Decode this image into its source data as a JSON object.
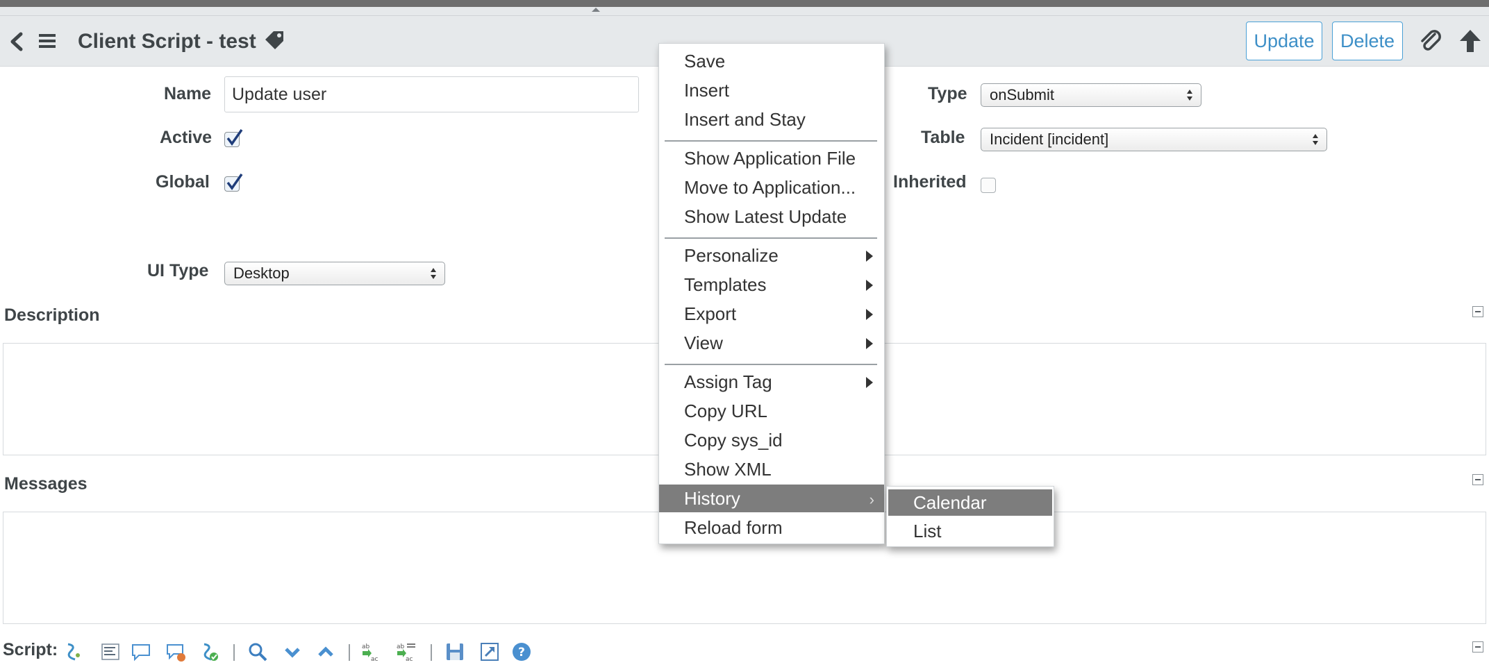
{
  "header": {
    "title": "Client Script - test",
    "update_label": "Update",
    "delete_label": "Delete"
  },
  "form": {
    "name_label": "Name",
    "name_value": "Update user",
    "active_label": "Active",
    "active_checked": true,
    "global_label": "Global",
    "global_checked": true,
    "ui_type_label": "UI Type",
    "ui_type_value": "Desktop",
    "type_label": "Type",
    "type_value": "onSubmit",
    "table_label": "Table",
    "table_value": "Incident [incident]",
    "inherited_label": "Inherited",
    "inherited_checked": false
  },
  "sections": {
    "description_label": "Description",
    "messages_label": "Messages",
    "script_label": "Script:"
  },
  "context_menu": {
    "items": [
      {
        "label": "Save"
      },
      {
        "label": "Insert"
      },
      {
        "label": "Insert and Stay"
      },
      {
        "label": "Show Application File"
      },
      {
        "label": "Move to Application..."
      },
      {
        "label": "Show Latest Update"
      },
      {
        "label": "Personalize",
        "submenu": true
      },
      {
        "label": "Templates",
        "submenu": true
      },
      {
        "label": "Export",
        "submenu": true
      },
      {
        "label": "View",
        "submenu": true
      },
      {
        "label": "Assign Tag",
        "submenu": true
      },
      {
        "label": "Copy URL"
      },
      {
        "label": "Copy sys_id"
      },
      {
        "label": "Show XML"
      },
      {
        "label": "History",
        "submenu": true,
        "active": true
      },
      {
        "label": "Reload form"
      }
    ]
  },
  "history_submenu": {
    "items": [
      {
        "label": "Calendar",
        "active": true
      },
      {
        "label": "List"
      }
    ]
  },
  "toolbar_icons": [
    "script-icon",
    "format-icon",
    "comment-icon",
    "uncomment-icon",
    "check-syntax-icon",
    "search-icon",
    "find-next-icon",
    "find-previous-icon",
    "replace-icon",
    "replace-all-icon",
    "save-icon",
    "fullscreen-icon",
    "help-icon"
  ],
  "colors": {
    "accent": "#3d8fc7",
    "header_bg": "#e6e9eb",
    "menu_active": "#7d7d7d"
  }
}
